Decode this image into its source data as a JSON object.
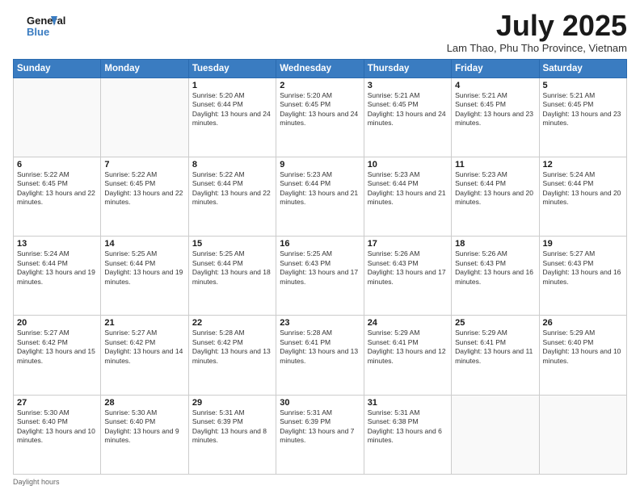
{
  "header": {
    "logo_line1": "General",
    "logo_line2": "Blue",
    "title": "July 2025",
    "subtitle": "Lam Thao, Phu Tho Province, Vietnam"
  },
  "days": [
    "Sunday",
    "Monday",
    "Tuesday",
    "Wednesday",
    "Thursday",
    "Friday",
    "Saturday"
  ],
  "weeks": [
    [
      {
        "date": "",
        "info": ""
      },
      {
        "date": "",
        "info": ""
      },
      {
        "date": "1",
        "info": "Sunrise: 5:20 AM\nSunset: 6:44 PM\nDaylight: 13 hours and 24 minutes."
      },
      {
        "date": "2",
        "info": "Sunrise: 5:20 AM\nSunset: 6:45 PM\nDaylight: 13 hours and 24 minutes."
      },
      {
        "date": "3",
        "info": "Sunrise: 5:21 AM\nSunset: 6:45 PM\nDaylight: 13 hours and 24 minutes."
      },
      {
        "date": "4",
        "info": "Sunrise: 5:21 AM\nSunset: 6:45 PM\nDaylight: 13 hours and 23 minutes."
      },
      {
        "date": "5",
        "info": "Sunrise: 5:21 AM\nSunset: 6:45 PM\nDaylight: 13 hours and 23 minutes."
      }
    ],
    [
      {
        "date": "6",
        "info": "Sunrise: 5:22 AM\nSunset: 6:45 PM\nDaylight: 13 hours and 22 minutes."
      },
      {
        "date": "7",
        "info": "Sunrise: 5:22 AM\nSunset: 6:45 PM\nDaylight: 13 hours and 22 minutes."
      },
      {
        "date": "8",
        "info": "Sunrise: 5:22 AM\nSunset: 6:44 PM\nDaylight: 13 hours and 22 minutes."
      },
      {
        "date": "9",
        "info": "Sunrise: 5:23 AM\nSunset: 6:44 PM\nDaylight: 13 hours and 21 minutes."
      },
      {
        "date": "10",
        "info": "Sunrise: 5:23 AM\nSunset: 6:44 PM\nDaylight: 13 hours and 21 minutes."
      },
      {
        "date": "11",
        "info": "Sunrise: 5:23 AM\nSunset: 6:44 PM\nDaylight: 13 hours and 20 minutes."
      },
      {
        "date": "12",
        "info": "Sunrise: 5:24 AM\nSunset: 6:44 PM\nDaylight: 13 hours and 20 minutes."
      }
    ],
    [
      {
        "date": "13",
        "info": "Sunrise: 5:24 AM\nSunset: 6:44 PM\nDaylight: 13 hours and 19 minutes."
      },
      {
        "date": "14",
        "info": "Sunrise: 5:25 AM\nSunset: 6:44 PM\nDaylight: 13 hours and 19 minutes."
      },
      {
        "date": "15",
        "info": "Sunrise: 5:25 AM\nSunset: 6:44 PM\nDaylight: 13 hours and 18 minutes."
      },
      {
        "date": "16",
        "info": "Sunrise: 5:25 AM\nSunset: 6:43 PM\nDaylight: 13 hours and 17 minutes."
      },
      {
        "date": "17",
        "info": "Sunrise: 5:26 AM\nSunset: 6:43 PM\nDaylight: 13 hours and 17 minutes."
      },
      {
        "date": "18",
        "info": "Sunrise: 5:26 AM\nSunset: 6:43 PM\nDaylight: 13 hours and 16 minutes."
      },
      {
        "date": "19",
        "info": "Sunrise: 5:27 AM\nSunset: 6:43 PM\nDaylight: 13 hours and 16 minutes."
      }
    ],
    [
      {
        "date": "20",
        "info": "Sunrise: 5:27 AM\nSunset: 6:42 PM\nDaylight: 13 hours and 15 minutes."
      },
      {
        "date": "21",
        "info": "Sunrise: 5:27 AM\nSunset: 6:42 PM\nDaylight: 13 hours and 14 minutes."
      },
      {
        "date": "22",
        "info": "Sunrise: 5:28 AM\nSunset: 6:42 PM\nDaylight: 13 hours and 13 minutes."
      },
      {
        "date": "23",
        "info": "Sunrise: 5:28 AM\nSunset: 6:41 PM\nDaylight: 13 hours and 13 minutes."
      },
      {
        "date": "24",
        "info": "Sunrise: 5:29 AM\nSunset: 6:41 PM\nDaylight: 13 hours and 12 minutes."
      },
      {
        "date": "25",
        "info": "Sunrise: 5:29 AM\nSunset: 6:41 PM\nDaylight: 13 hours and 11 minutes."
      },
      {
        "date": "26",
        "info": "Sunrise: 5:29 AM\nSunset: 6:40 PM\nDaylight: 13 hours and 10 minutes."
      }
    ],
    [
      {
        "date": "27",
        "info": "Sunrise: 5:30 AM\nSunset: 6:40 PM\nDaylight: 13 hours and 10 minutes."
      },
      {
        "date": "28",
        "info": "Sunrise: 5:30 AM\nSunset: 6:40 PM\nDaylight: 13 hours and 9 minutes."
      },
      {
        "date": "29",
        "info": "Sunrise: 5:31 AM\nSunset: 6:39 PM\nDaylight: 13 hours and 8 minutes."
      },
      {
        "date": "30",
        "info": "Sunrise: 5:31 AM\nSunset: 6:39 PM\nDaylight: 13 hours and 7 minutes."
      },
      {
        "date": "31",
        "info": "Sunrise: 5:31 AM\nSunset: 6:38 PM\nDaylight: 13 hours and 6 minutes."
      },
      {
        "date": "",
        "info": ""
      },
      {
        "date": "",
        "info": ""
      }
    ]
  ],
  "footer": "Daylight hours"
}
